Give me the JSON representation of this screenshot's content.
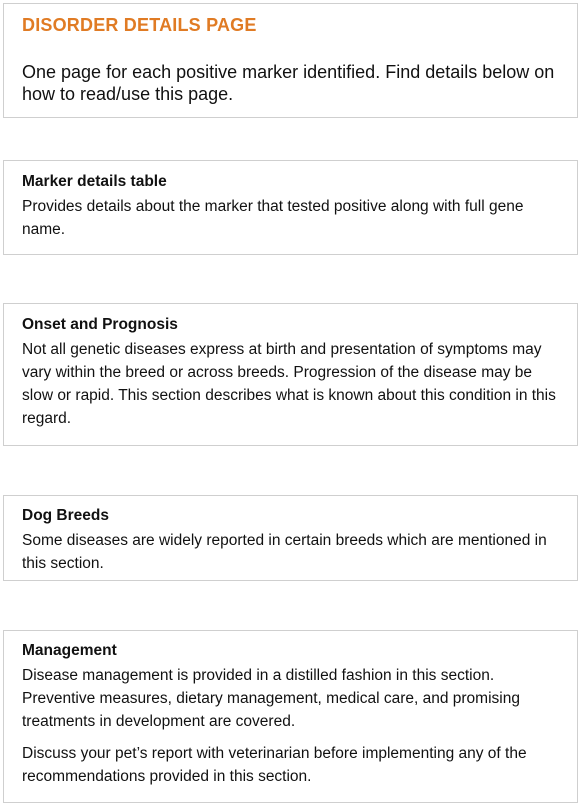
{
  "intro": {
    "title": "DISORDER DETAILS PAGE",
    "text": "One page for each positive marker identified. Find details below on how to read/use this page."
  },
  "sections": [
    {
      "heading": "Marker details table",
      "paragraphs": [
        "Provides details about the marker that tested positive along with full gene name."
      ]
    },
    {
      "heading": "Onset and Prognosis",
      "paragraphs": [
        "Not all genetic diseases express at birth and presentation of symptoms may vary within the breed or across breeds. Progression of the disease may be slow or rapid. This section describes what is known about this condition in this regard."
      ]
    },
    {
      "heading": "Dog Breeds",
      "paragraphs": [
        "Some diseases are widely reported in certain breeds which are mentioned in this section."
      ]
    },
    {
      "heading": "Management",
      "paragraphs": [
        "Disease management is provided in a distilled fashion in this section.  Preventive measures, dietary management, medical care, and promising treatments in development are covered.",
        "Discuss your pet’s report with veterinarian before implementing any of the recommendations provided in this section."
      ]
    }
  ],
  "colors": {
    "title_accent": "#e07b24",
    "border": "#cfcfcf",
    "text": "#111111"
  }
}
